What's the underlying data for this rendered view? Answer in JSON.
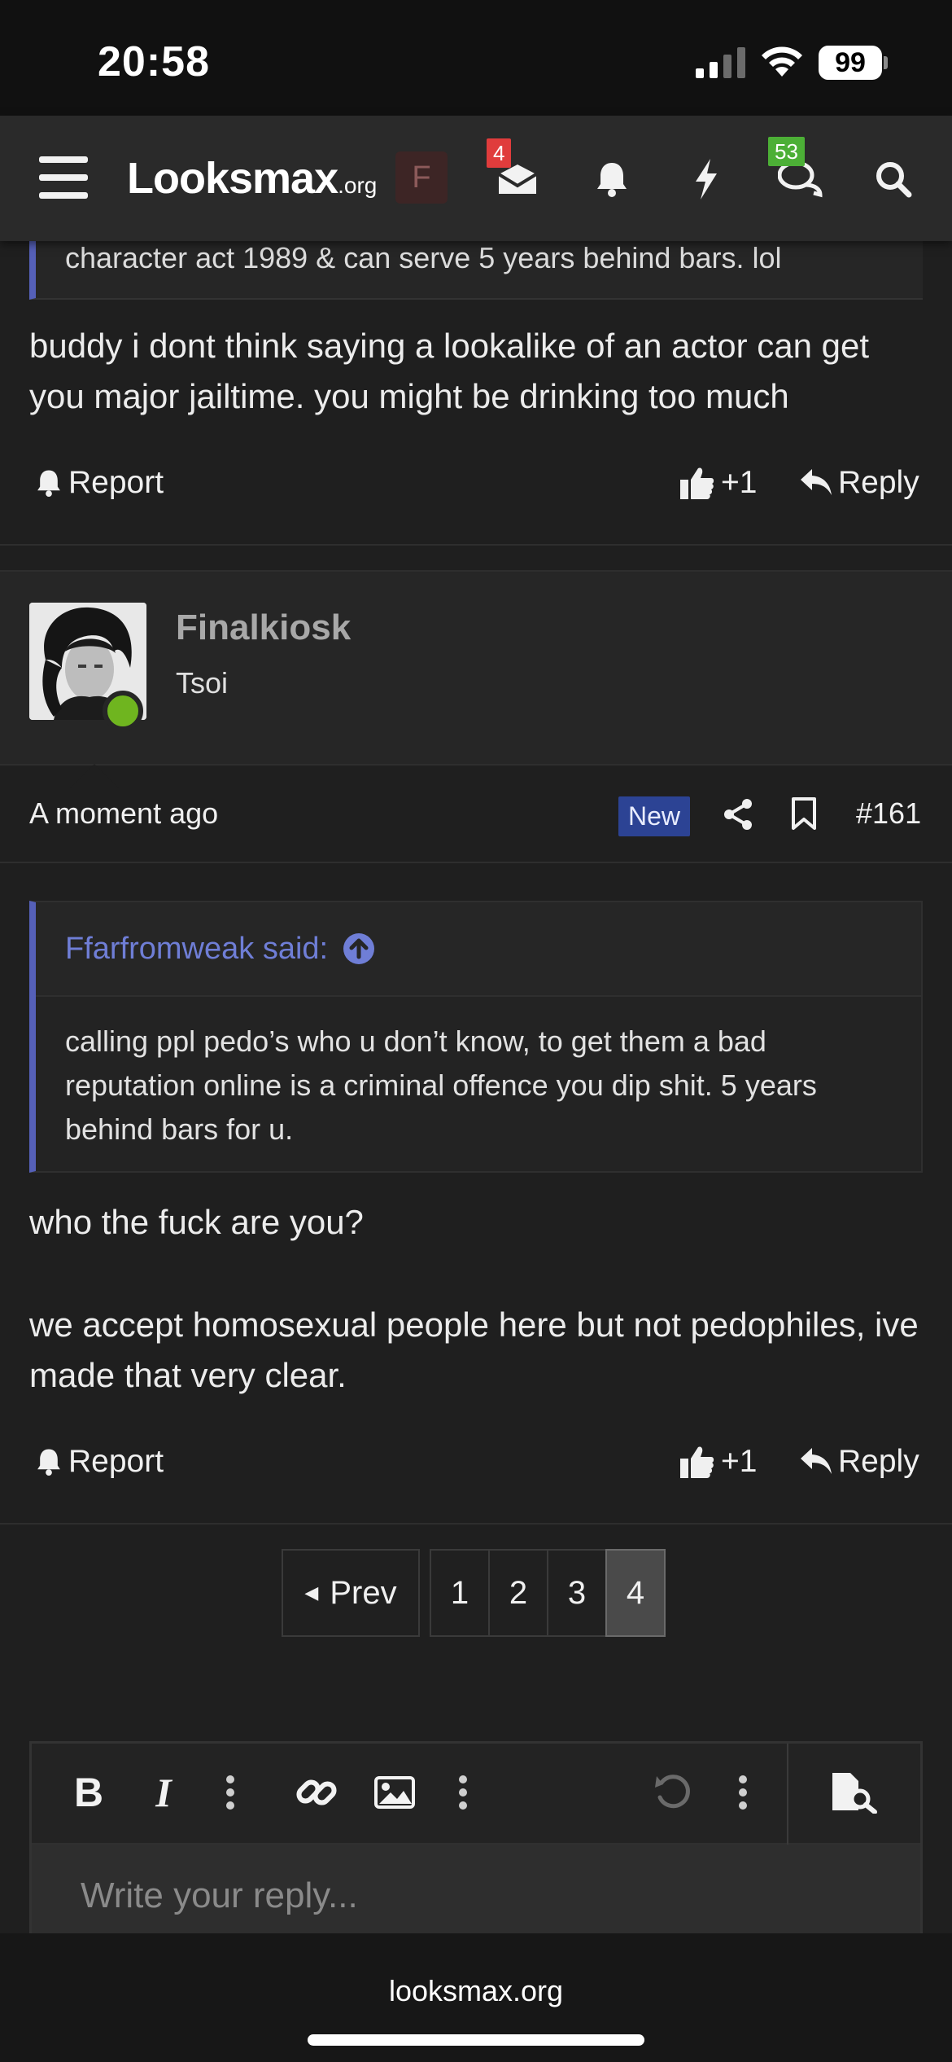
{
  "status_bar": {
    "time": "20:58",
    "battery": "99"
  },
  "nav": {
    "logo_main": "Looksmax",
    "logo_suffix": ".org",
    "avatar_letter": "F",
    "inbox_badge": "4",
    "chats_badge": "53"
  },
  "previous_post": {
    "quote_tail": "character act 1989 & can serve 5 years behind bars. lol",
    "text": "buddy i dont think saying a lookalike of an actor can get you major jailtime. you might be drinking too much",
    "report_label": "Report",
    "like_label": "+1",
    "reply_label": "Reply"
  },
  "post": {
    "username": "Finalkiosk",
    "user_title": "Tsoi",
    "time": "A moment ago",
    "new_badge": "New",
    "post_number": "#161",
    "quote_author": "Ffarfromweak said:",
    "quote_text": "calling ppl pedo’s who u don’t know, to get them a bad reputation online is a criminal offence you dip shit. 5 years behind bars for u.",
    "line1": "who the fuck are you?",
    "line2": "we accept homosexual people here but not pedophiles, ive made that very clear.",
    "report_label": "Report",
    "like_label": "+1",
    "reply_label": "Reply"
  },
  "pagination": {
    "prev_label": "Prev",
    "pages": [
      "1",
      "2",
      "3",
      "4"
    ],
    "current_page": "4"
  },
  "editor": {
    "placeholder": "Write your reply..."
  },
  "footer": {
    "domain": "looksmax.org"
  }
}
